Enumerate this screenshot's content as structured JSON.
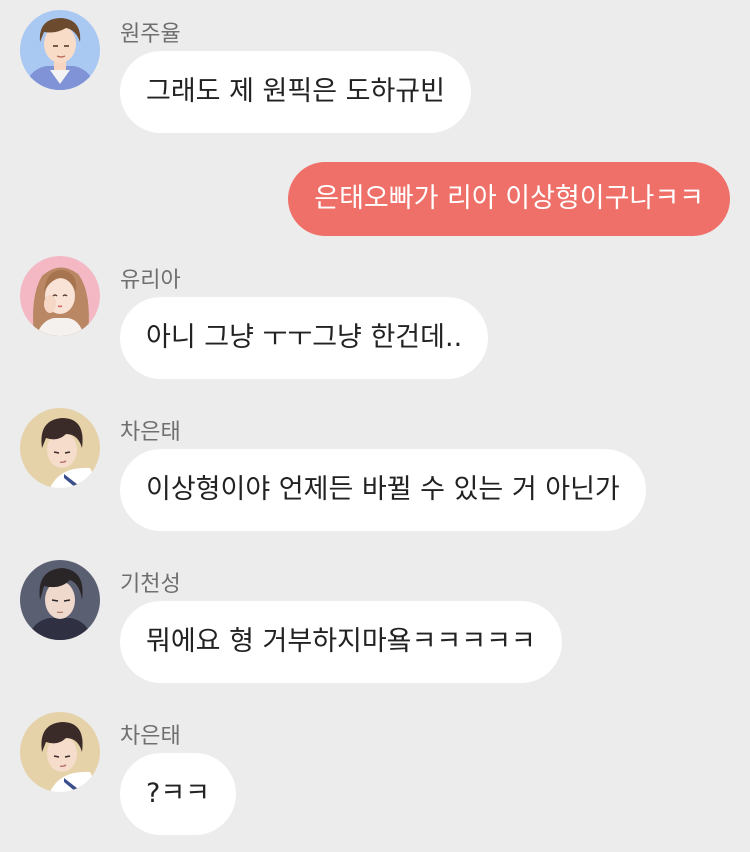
{
  "messages": [
    {
      "sender": "원주율",
      "text": "그래도 제 원픽은 도하규빈",
      "avatar_icon": "juyul-avatar"
    },
    {
      "sender": "",
      "text": "은태오빠가 리아 이상형이구나ㅋㅋ",
      "outgoing": true
    },
    {
      "sender": "유리아",
      "text": "아니 그냥 ㅜㅜ그냥 한건데..",
      "avatar_icon": "ria-avatar"
    },
    {
      "sender": "차은태",
      "text": "이상형이야 언제든 바뀔 수 있는 거 아닌가",
      "avatar_icon": "euntae-avatar"
    },
    {
      "sender": "기천성",
      "text": "뭐에요 형 거부하지마욬ㅋㅋㅋㅋㅋ",
      "avatar_icon": "cheonseong-avatar"
    },
    {
      "sender": "차은태",
      "text": "?ㅋㅋ",
      "avatar_icon": "euntae-avatar"
    }
  ],
  "colors": {
    "background": "#ececec",
    "incoming_bubble": "#ffffff",
    "outgoing_bubble": "#ef7069",
    "sender_text": "#6f6f6f"
  }
}
